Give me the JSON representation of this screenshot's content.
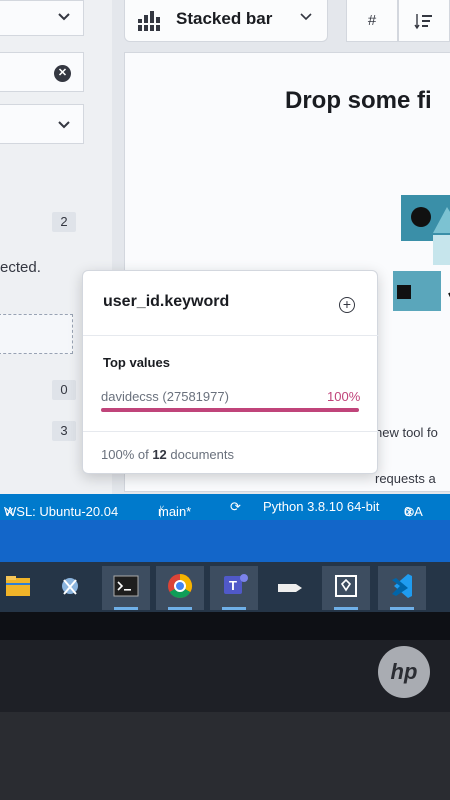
{
  "left_panel": {
    "selected_text": "ected.",
    "badges": [
      "2",
      "0",
      "3"
    ]
  },
  "toolbar": {
    "chart_type_label": "Stacked bar",
    "hash_label": "#"
  },
  "workspace": {
    "title": "Drop some fi",
    "new_tool_text": "new tool fo",
    "requests_text": "requests a"
  },
  "popover": {
    "field_name": "user_id.keyword",
    "section_title": "Top values",
    "top_value_label": "davidecss (27581977)",
    "top_value_percent_label": "100%",
    "top_value_fraction": 1.0,
    "summary_prefix": "100% of ",
    "summary_count": "12",
    "summary_suffix": " documents"
  },
  "statusbar": {
    "remote": "WSL: Ubuntu-20.04",
    "branch": "main*",
    "interpreter": "Python 3.8.10 64-bit",
    "errors": "0 A"
  },
  "colors": {
    "status_bar": "#007acc",
    "value_bar": "#c0447a",
    "taskbar": "#253547"
  },
  "taskbar_icons": [
    "file-explorer-icon",
    "snipping-tool-icon",
    "terminal-icon",
    "chrome-icon",
    "teams-icon",
    "app-icon",
    "unity-icon",
    "vscode-icon"
  ]
}
